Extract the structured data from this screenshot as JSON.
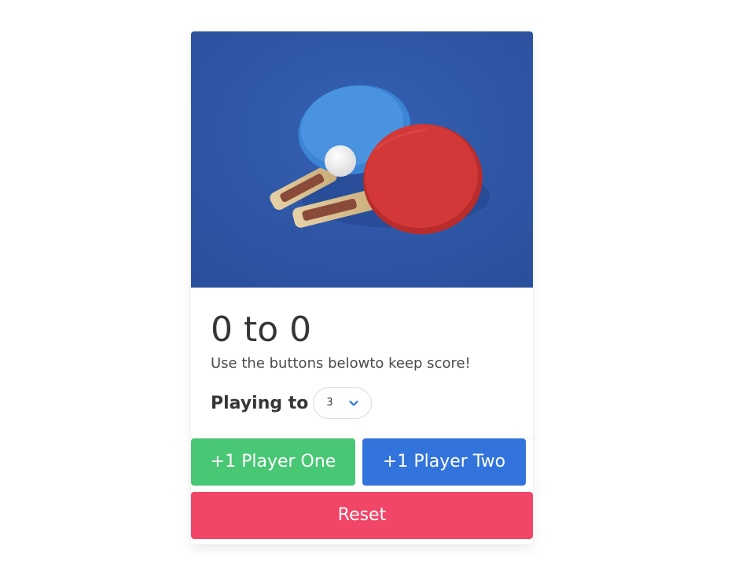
{
  "image": {
    "description_icon": "ping-pong-paddles-image",
    "colors": {
      "table": "#2e55a6",
      "paddle_blue": "#3d87d8",
      "paddle_red": "#cd3535",
      "ball": "#f4f4f4"
    }
  },
  "score": {
    "text": "0 to 0"
  },
  "subtitle": "Use the buttons belowto keep score!",
  "playing_to": {
    "label": "Playing to",
    "selected": "3"
  },
  "buttons": {
    "player_one": "+1 Player One",
    "player_two": "+1 Player Two",
    "reset": "Reset"
  },
  "colors": {
    "player_one": "#48c774",
    "player_two": "#3273dc",
    "reset": "#f14668"
  }
}
